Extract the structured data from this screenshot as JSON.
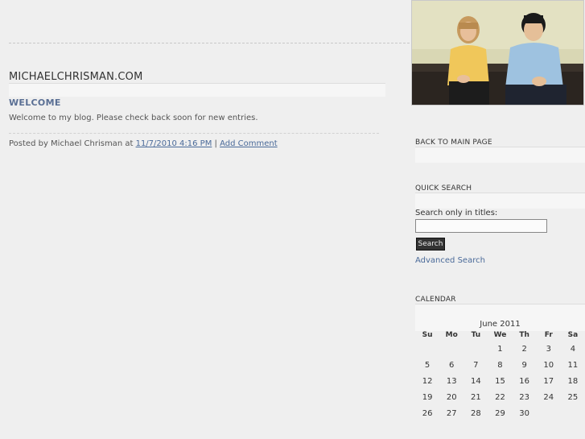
{
  "site": {
    "title": "MICHAELCHRISMAN.COM"
  },
  "post": {
    "title": "WELCOME",
    "body": "Welcome to my blog. Please check back soon for new entries.",
    "posted_by_prefix": "Posted by Michael Chrisman at",
    "date_link": "11/7/2010 4:16 PM",
    "separator": "|",
    "comment_link": "Add Comment"
  },
  "sidebar": {
    "back_title": "BACK TO MAIN PAGE",
    "search_title": "QUICK SEARCH",
    "search_label": "Search only in titles:",
    "search_value": "",
    "search_button": "Search",
    "advanced_link": "Advanced Search",
    "calendar_title": "CALENDAR"
  },
  "calendar": {
    "month": "June 2011",
    "days": [
      "Su",
      "Mo",
      "Tu",
      "We",
      "Th",
      "Fr",
      "Sa"
    ],
    "weeks": [
      [
        "",
        "",
        "",
        "1",
        "2",
        "3",
        "4"
      ],
      [
        "5",
        "6",
        "7",
        "8",
        "9",
        "10",
        "11"
      ],
      [
        "12",
        "13",
        "14",
        "15",
        "16",
        "17",
        "18"
      ],
      [
        "19",
        "20",
        "21",
        "22",
        "23",
        "24",
        "25"
      ],
      [
        "26",
        "27",
        "28",
        "29",
        "30",
        "",
        ""
      ]
    ]
  },
  "colors": {
    "background": "#efefef",
    "link": "#4a6a99",
    "post_title": "#5a6f94",
    "photo_wall": "#d9d7b4"
  }
}
